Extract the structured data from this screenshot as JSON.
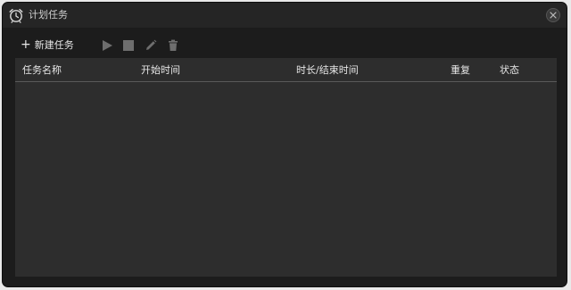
{
  "window": {
    "title": "计划任务",
    "app_icon": "alarm-clock-icon",
    "close_icon": "close-icon"
  },
  "toolbar": {
    "new_task_label": "新建任务",
    "new_task_icon": "plus-icon",
    "buttons": [
      {
        "name": "start-button",
        "icon": "play-icon"
      },
      {
        "name": "stop-button",
        "icon": "stop-icon"
      },
      {
        "name": "edit-button",
        "icon": "pencil-icon"
      },
      {
        "name": "delete-button",
        "icon": "trash-icon"
      }
    ]
  },
  "table": {
    "columns": [
      "任务名称",
      "开始时间",
      "时长/结束时间",
      "重复",
      "状态"
    ],
    "rows": []
  },
  "colors": {
    "window_bg": "#1c1c1c",
    "titlebar_bg": "#252525",
    "panel_bg": "#2d2d2d",
    "text": "#e6e6e6",
    "disabled_icon": "#6e6e6e"
  }
}
